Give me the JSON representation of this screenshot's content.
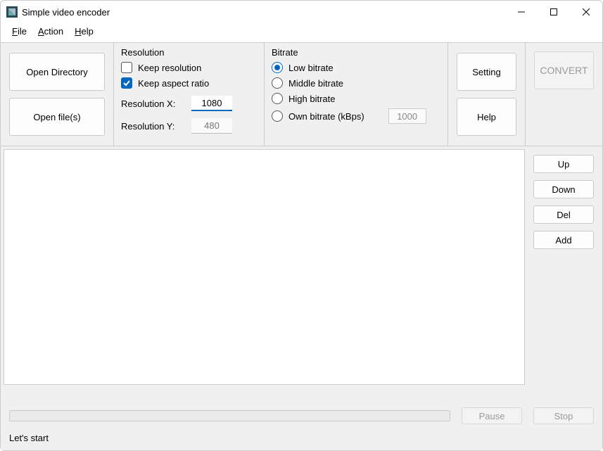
{
  "window": {
    "title": "Simple video encoder"
  },
  "menu": {
    "file": "File",
    "action": "Action",
    "help": "Help"
  },
  "open": {
    "open_directory": "Open Directory",
    "open_files": "Open file(s)"
  },
  "resolution": {
    "title": "Resolution",
    "keep_resolution_label": "Keep resolution",
    "keep_resolution_checked": false,
    "keep_aspect_label": "Keep aspect ratio",
    "keep_aspect_checked": true,
    "res_x_label": "Resolution X:",
    "res_x_value": "1080",
    "res_y_label": "Resolution Y:",
    "res_y_value": "480"
  },
  "bitrate": {
    "title": "Bitrate",
    "low_label": "Low bitrate",
    "middle_label": "Middle bitrate",
    "high_label": "High bitrate",
    "own_label": "Own bitrate (kBps)",
    "own_value": "1000",
    "selected": "low"
  },
  "right": {
    "setting": "Setting",
    "help": "Help",
    "convert": "CONVERT"
  },
  "side": {
    "up": "Up",
    "down": "Down",
    "del": "Del",
    "add": "Add"
  },
  "bottom": {
    "pause": "Pause",
    "stop": "Stop"
  },
  "status": {
    "text": "Let's start"
  }
}
